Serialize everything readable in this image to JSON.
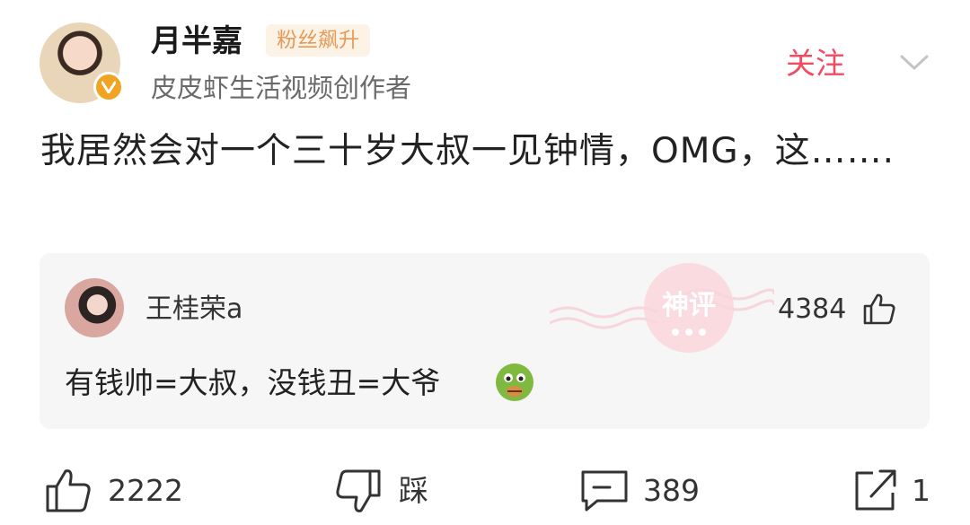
{
  "author": {
    "name": "月半嘉",
    "badge": "粉丝飙升",
    "description": "皮皮虾生活视频创作者",
    "follow_label": "关注"
  },
  "post": {
    "text": "我居然会对一个三十岁大叔一见钟情，OMG，这……."
  },
  "hot_comment": {
    "username": "王桂荣a",
    "likes": "4384",
    "text": "有钱帅=大叔，没钱丑=大爷",
    "stamp": "神评"
  },
  "actions": {
    "like_count": "2222",
    "dislike_label": "踩",
    "comment_count": "389",
    "share_count": "1"
  },
  "colors": {
    "accent": "#f24b61",
    "badge_text": "#e59a58",
    "badge_bg": "#fdf2e6",
    "verified": "#f0a421"
  }
}
